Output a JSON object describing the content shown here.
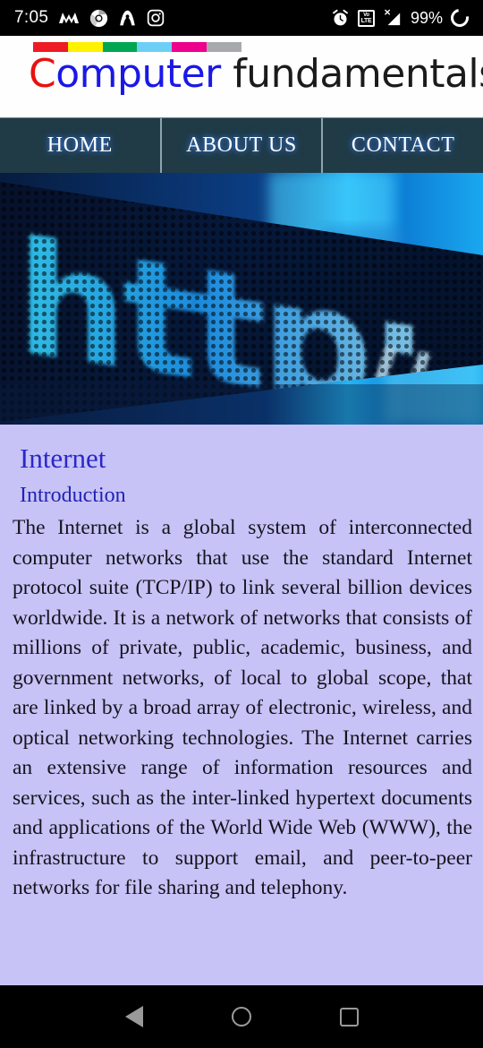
{
  "status_bar": {
    "time": "7:05",
    "battery_percent": "99%",
    "left_icons": [
      "m-logo-icon",
      "chrome-icon",
      "amazon-alexa-icon",
      "instagram-icon"
    ],
    "right_icons": [
      "alarm-icon",
      "volte-icon",
      "signal-bars-icon",
      "battery-icon"
    ],
    "volte_top": "Vo",
    "volte_bottom": "LTE",
    "signal_x": "X"
  },
  "header": {
    "logo_part1": "C",
    "logo_part2": "omputer",
    "logo_part3": " fundamentals",
    "logo_full": "Computer fundamentals",
    "color_bar": [
      "#ee1b24",
      "#fff200",
      "#00a651",
      "#6dcff6",
      "#ec008c",
      "#a7a9ac"
    ]
  },
  "site_nav": {
    "items": [
      {
        "label": "HOME"
      },
      {
        "label": "ABOUT US"
      },
      {
        "label": "CONTACT"
      }
    ]
  },
  "banner": {
    "alt": "blue LED matrix display showing http://www.",
    "text_on_led": "http://www."
  },
  "content": {
    "title": "Internet",
    "subtitle": "Introduction",
    "paragraph": "The Internet is a global system of interconnected computer networks that use the standard Internet protocol suite (TCP/IP) to link several billion devices worldwide. It is a network of networks that consists of millions of private, public, academic, business, and government networks, of local to global scope, that are linked by a broad array of electronic, wireless, and optical networking technologies. The Internet carries an extensive range of information resources and services, such as the inter-linked hypertext documents and applications of the World Wide Web (WWW), the infrastructure to support email, and peer-to-peer networks for file sharing and telephony."
  },
  "android_nav": {
    "back_label": "Back",
    "home_label": "Home",
    "recents_label": "Recents"
  },
  "colors": {
    "status_bar_bg": "#000000",
    "header_bg": "#fefefe",
    "site_nav_bg": "#203b46",
    "content_bg": "#c7c3f7",
    "title_color": "#2a28c8",
    "logo_red": "#e8110f",
    "logo_blue": "#1a18e6"
  }
}
